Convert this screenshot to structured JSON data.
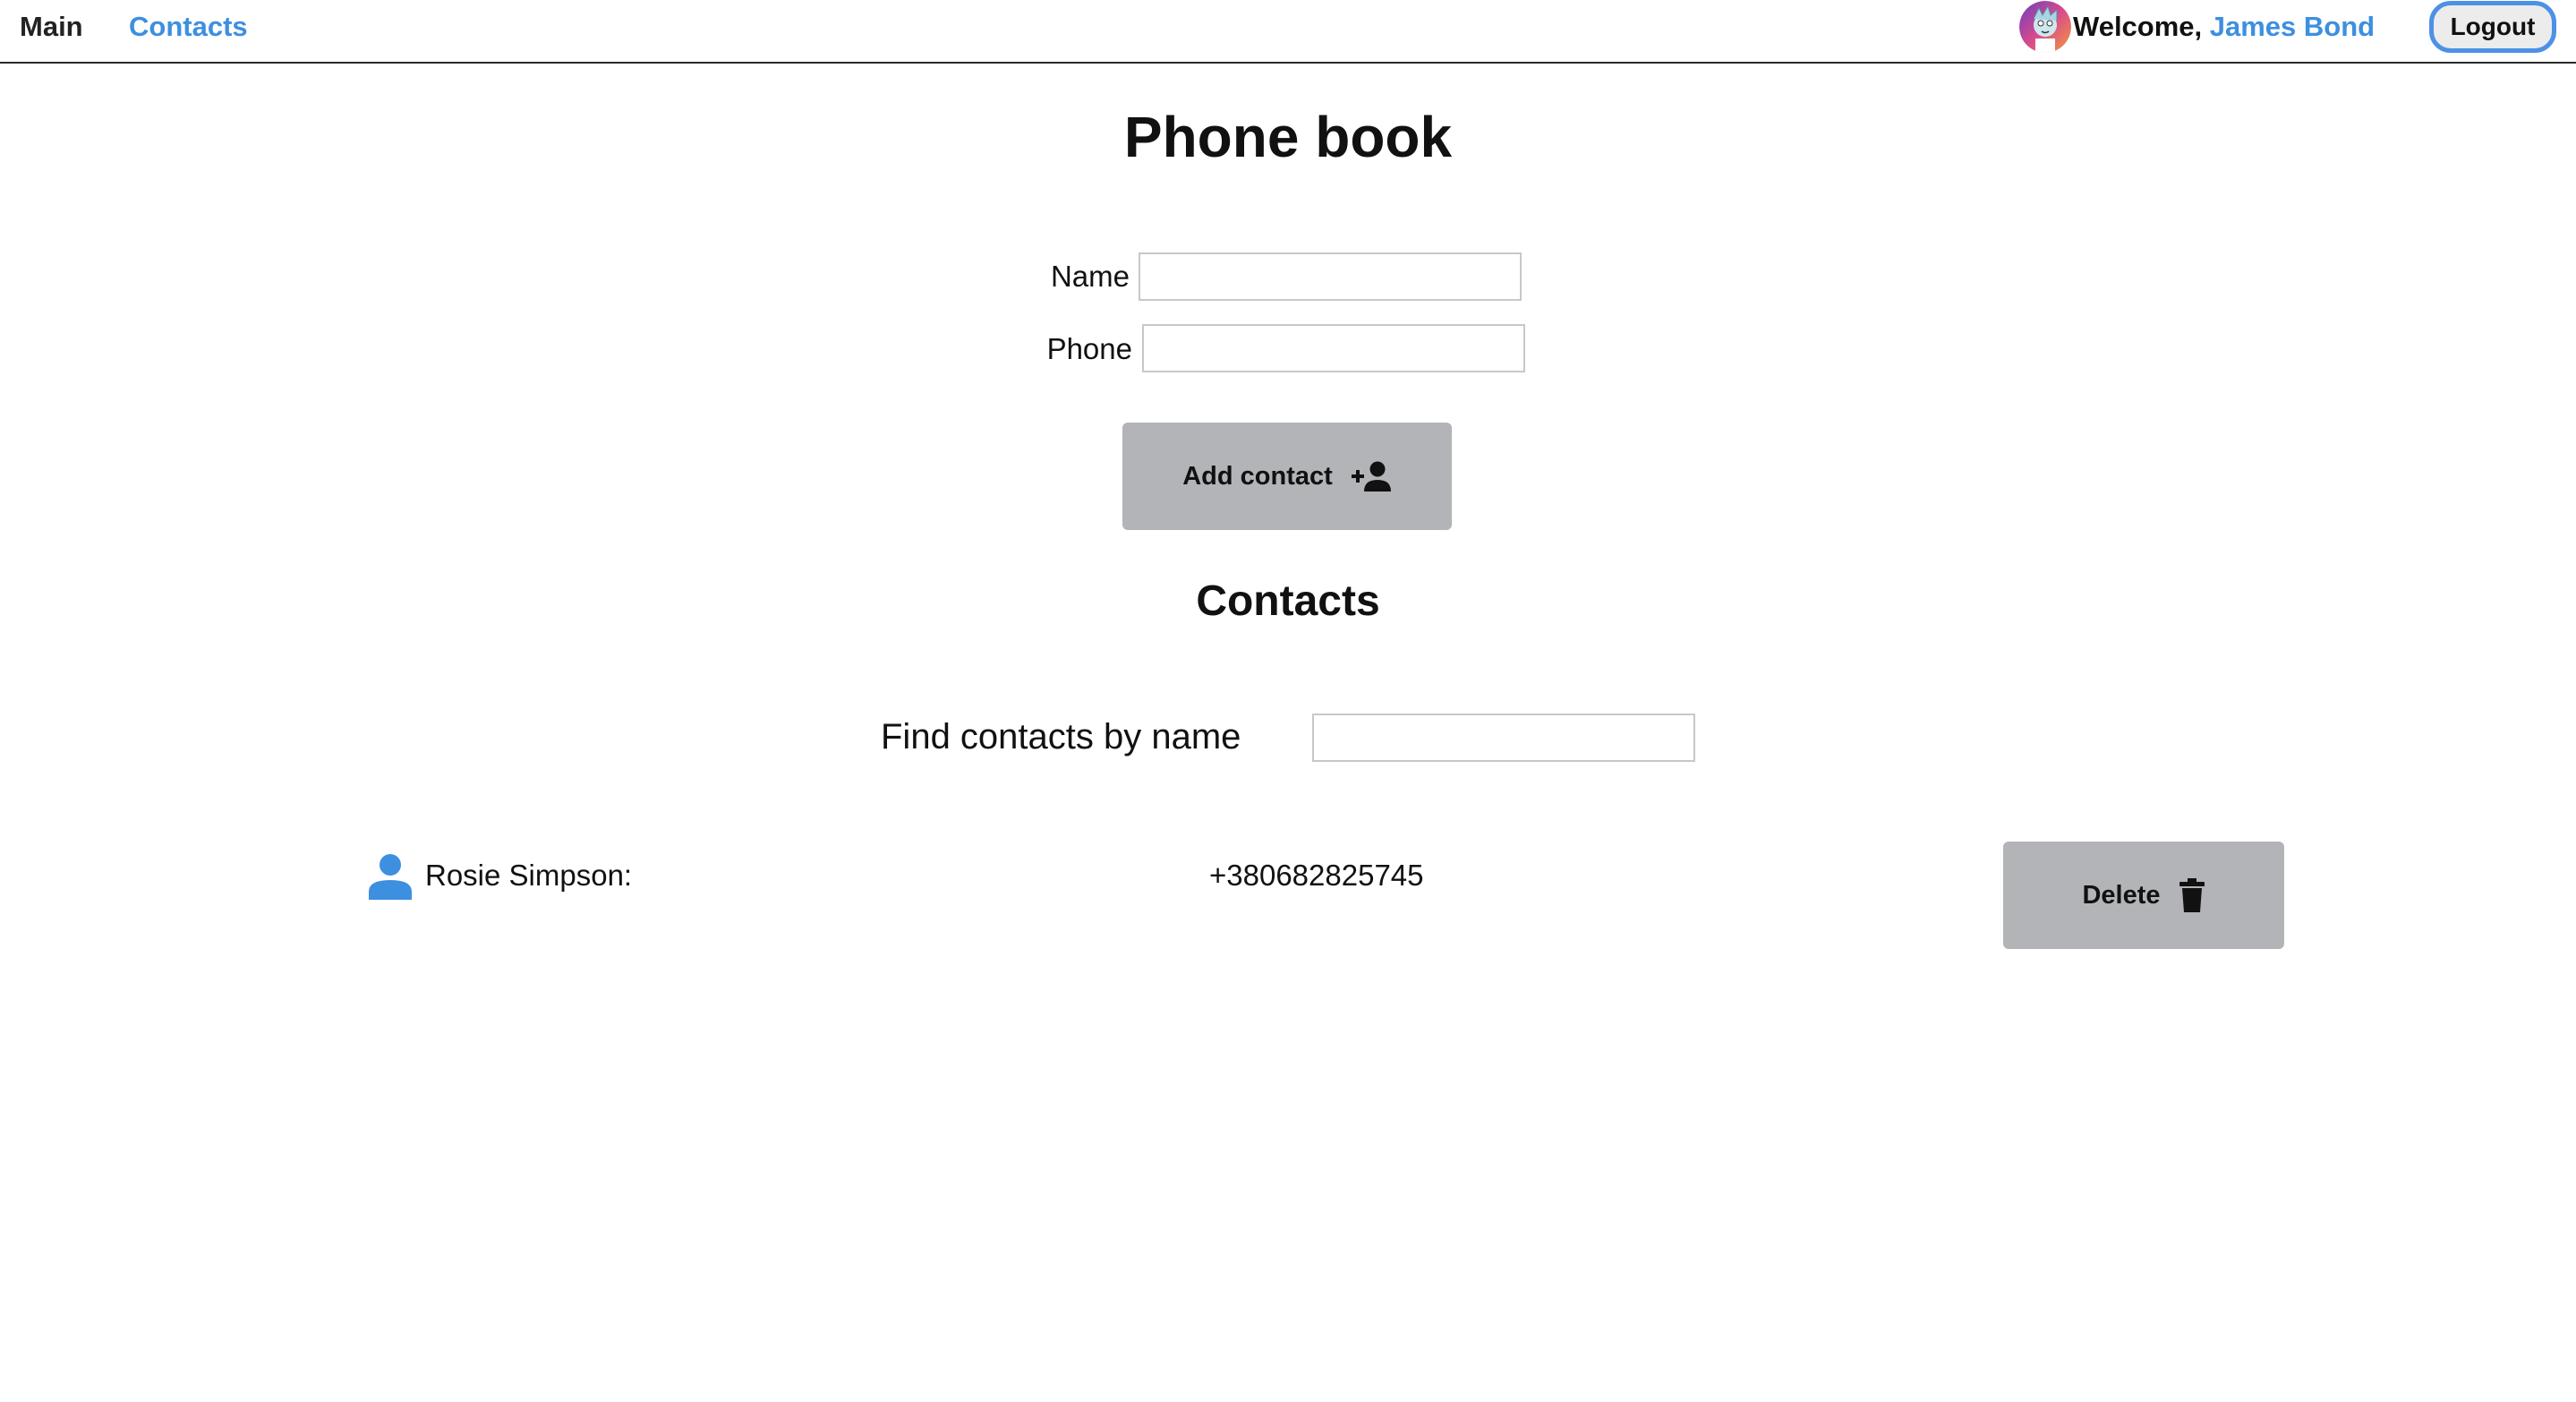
{
  "nav": {
    "main_label": "Main",
    "contacts_label": "Contacts"
  },
  "user": {
    "welcome_text": "Welcome, ",
    "name": "James Bond",
    "logout_label": "Logout",
    "avatar_icon": "avatar-image"
  },
  "page": {
    "title": "Phone book"
  },
  "form": {
    "name_label": "Name",
    "name_value": "",
    "phone_label": "Phone",
    "phone_value": "",
    "add_button_label": "Add contact",
    "add_button_icon": "person-add-icon"
  },
  "contacts_section": {
    "title": "Contacts",
    "filter_label": "Find contacts by name",
    "filter_value": ""
  },
  "contacts": [
    {
      "name": "Rosie Simpson:",
      "phone": "+380682825745",
      "icon": "person-icon",
      "delete_label": "Delete",
      "delete_icon": "trash-icon"
    }
  ],
  "colors": {
    "accent": "#3d8fe0",
    "button_bg": "#b3b4b8",
    "logout_border": "#4c91e6"
  }
}
